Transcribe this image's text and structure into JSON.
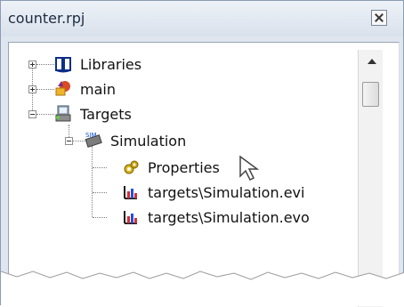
{
  "window": {
    "title": "counter.rpj"
  },
  "tree": {
    "items": [
      {
        "label": "Libraries",
        "icon": "book-icon"
      },
      {
        "label": "main",
        "icon": "main-icon"
      },
      {
        "label": "Targets",
        "icon": "targets-icon"
      },
      {
        "label": "Simulation",
        "icon": "sim-icon"
      },
      {
        "label": "Properties",
        "icon": "gear-icon"
      },
      {
        "label": "targets\\Simulation.evi",
        "icon": "chart-icon"
      },
      {
        "label": "targets\\Simulation.evo",
        "icon": "chart-icon"
      }
    ]
  }
}
